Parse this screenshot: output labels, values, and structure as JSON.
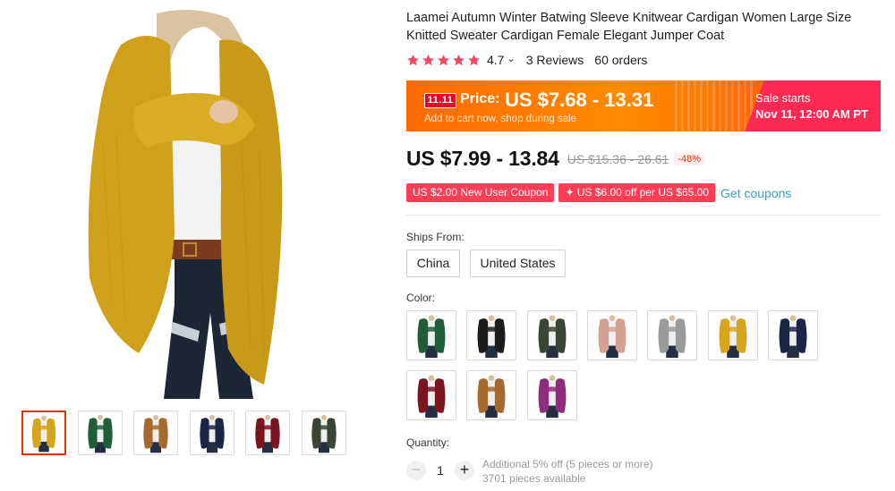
{
  "product": {
    "title": "Laamei Autumn Winter Batwing Sleeve Knitwear Cardigan Women Large Size Knitted Sweater Cardigan Female Elegant Jumper Coat",
    "rating": "4.7",
    "rating_chevron": "⌄",
    "rating_stars": 5,
    "reviews": "3 Reviews",
    "orders": "60 orders"
  },
  "banner": {
    "badge": "11.11",
    "price_label": "Price:",
    "price": "US $7.68 - 13.31",
    "subtext": "Add to cart now, shop during sale",
    "sale_title": "Sale starts",
    "sale_date": "Nov 11, 12:00 AM PT"
  },
  "price": {
    "current": "US $7.99 - 13.84",
    "original": "US $15.36 - 26.61",
    "discount": "-48%"
  },
  "coupons": {
    "new_user": "US $2.00 New User Coupon",
    "store": "✦ US $6.00 off per US $65.00",
    "get_coupons": "Get coupons"
  },
  "ships_from": {
    "label": "Ships From:",
    "options": [
      "China",
      "United States"
    ]
  },
  "color": {
    "label": "Color:",
    "swatches": [
      {
        "name": "green",
        "hex": "#1f5e3a"
      },
      {
        "name": "black",
        "hex": "#1b1b1b"
      },
      {
        "name": "dark green",
        "hex": "#3a4536"
      },
      {
        "name": "pink",
        "hex": "#d4a08f"
      },
      {
        "name": "gray",
        "hex": "#9a9a9a"
      },
      {
        "name": "yellow",
        "hex": "#d7a51d"
      },
      {
        "name": "navy",
        "hex": "#1d2546"
      },
      {
        "name": "wine red",
        "hex": "#7a1520"
      },
      {
        "name": "camel",
        "hex": "#a56a2e"
      },
      {
        "name": "purple",
        "hex": "#8e2c7e"
      }
    ]
  },
  "gallery": {
    "selected_index": 0,
    "thumbnails": [
      {
        "color": "#d7a51d"
      },
      {
        "color": "#1f5e3a"
      },
      {
        "color": "#a56a2e"
      },
      {
        "color": "#1d2546"
      },
      {
        "color": "#7a1520"
      },
      {
        "color": "#3a4536"
      }
    ]
  },
  "quantity": {
    "label": "Quantity:",
    "minus": "−",
    "value": "1",
    "plus": "+",
    "note": "Additional 5% off (5 pieces or more)",
    "available": "3701 pieces available"
  },
  "colors": {
    "accent_red": "#e62e04",
    "star": "#f44a62",
    "coupon": "#ff3d54",
    "link": "#3aa0b8",
    "banner_orange": "#ff7a00",
    "banner_pink": "#ff2a53"
  }
}
